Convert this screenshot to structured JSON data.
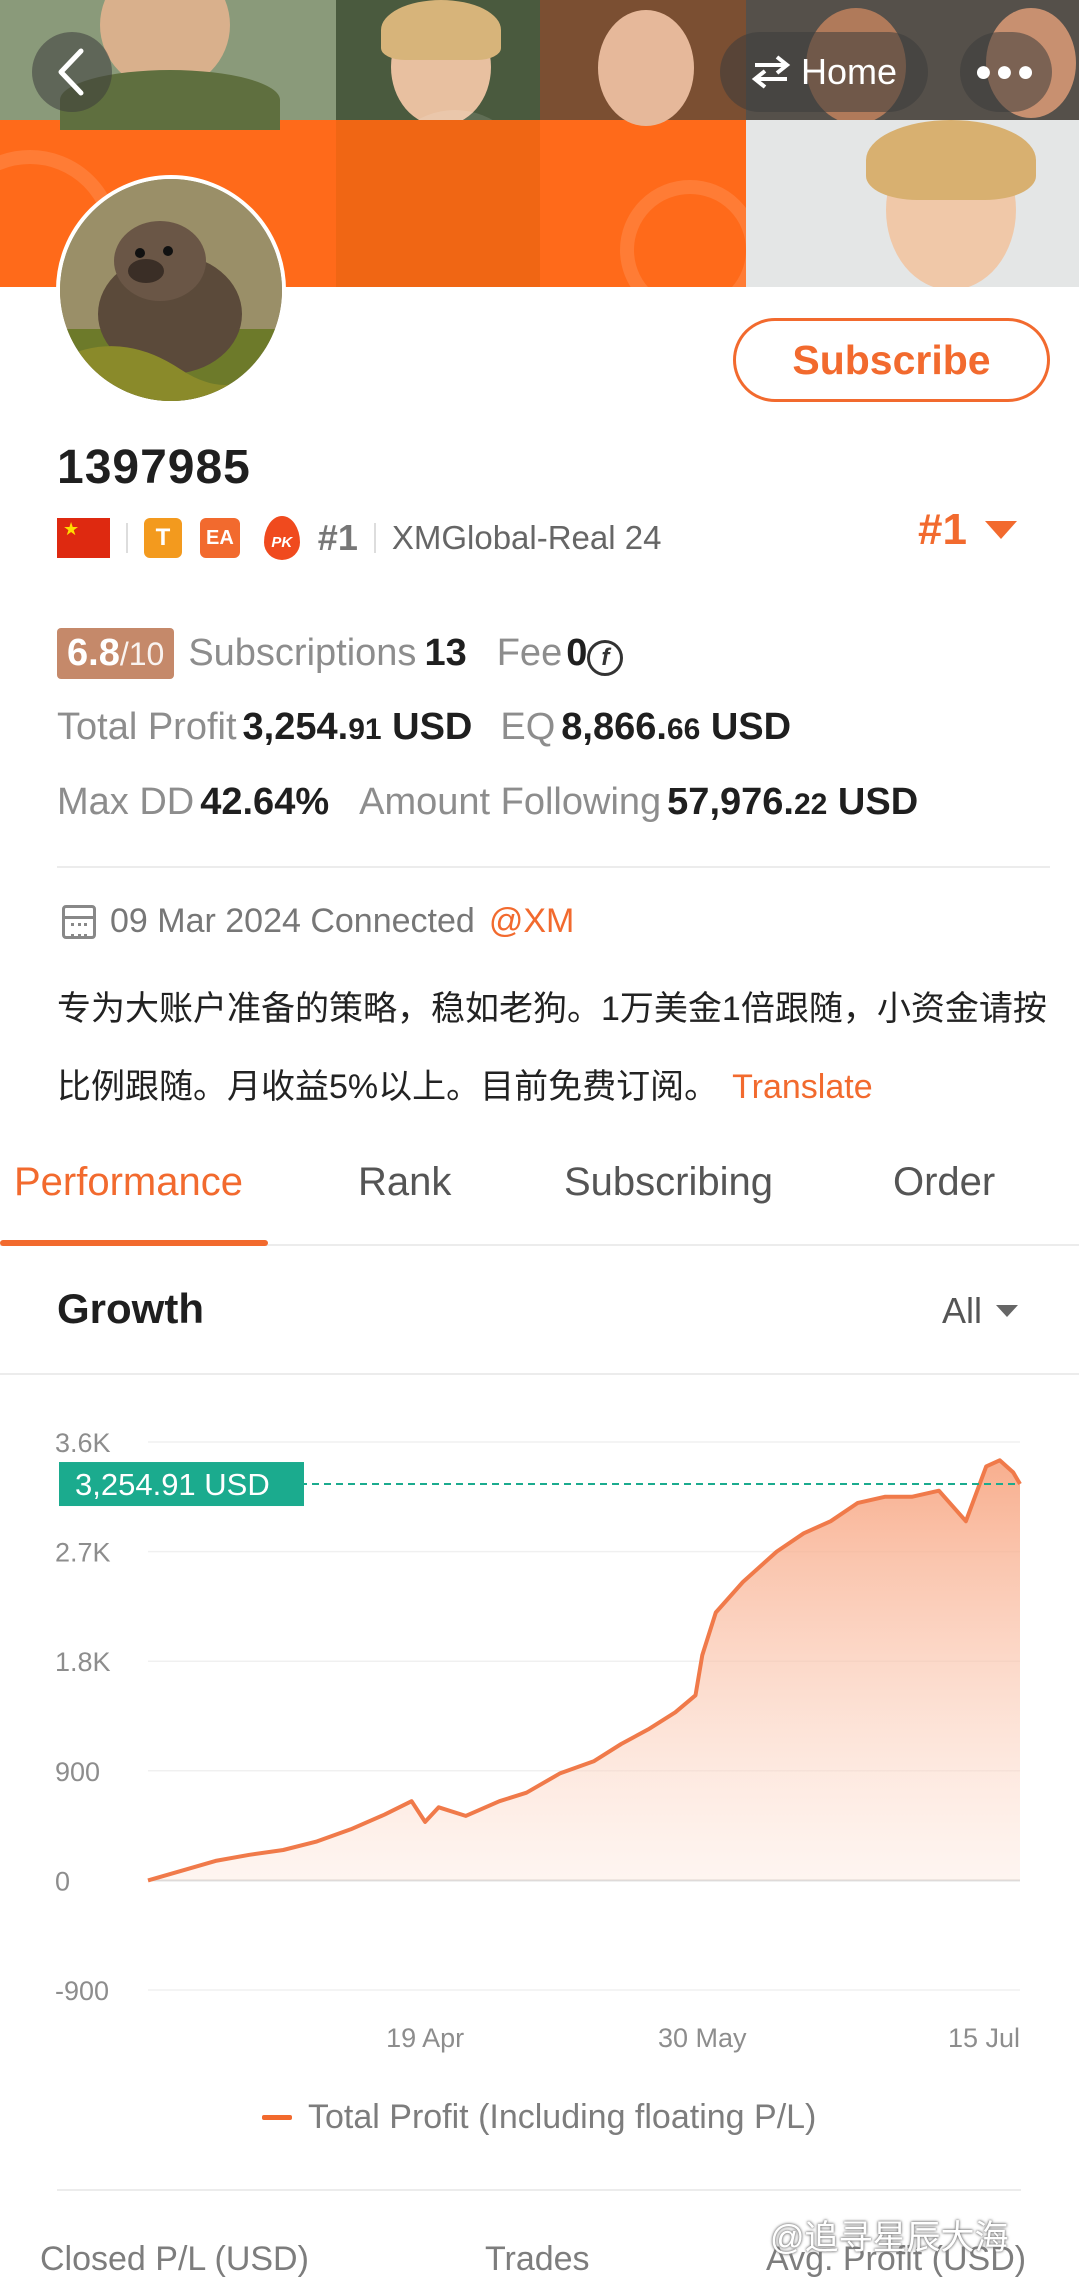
{
  "header": {
    "back_icon": "chevron-left-icon",
    "home_label": "Home",
    "home_icon": "swap-icon",
    "more_icon": "more-dots-icon"
  },
  "profile": {
    "subscribe_label": "Subscribe",
    "account_id": "1397985",
    "badge_t": "T",
    "badge_ea": "EA",
    "badge_pk": "PK",
    "rank": "#1",
    "server": "XMGlobal-Real 24",
    "rank_dropdown": "#1"
  },
  "stats": {
    "score": "6.8",
    "score_max": "/10",
    "subscriptions_label": "Subscriptions",
    "subscriptions_value": "13",
    "fee_label": "Fee",
    "fee_value": "0",
    "fee_icon": "f-coin-icon",
    "total_profit_label": "Total Profit",
    "total_profit_int": "3,254.",
    "total_profit_dec": "91",
    "total_profit_unit": "USD",
    "eq_label": "EQ",
    "eq_int": "8,866.",
    "eq_dec": "66",
    "eq_unit": "USD",
    "max_dd_label": "Max DD",
    "max_dd_value": "42.64%",
    "amount_following_label": "Amount Following",
    "amount_following_int": "57,976.",
    "amount_following_dec": "22",
    "amount_following_unit": "USD"
  },
  "connection": {
    "date_text": "09 Mar 2024 Connected",
    "broker": "@XM"
  },
  "description": {
    "text": "专为大账户准备的策略，稳如老狗。1万美金1倍跟随，小资金请按比例跟随。月收益5%以上。目前免费订阅。",
    "translate_label": "Translate"
  },
  "tabs": [
    "Performance",
    "Rank",
    "Subscribing",
    "Order"
  ],
  "growth": {
    "title": "Growth",
    "range": "All"
  },
  "chart_data": {
    "type": "area",
    "y_ticks": [
      "3.6K",
      "2.7K",
      "1.8K",
      "900",
      "0",
      "-900"
    ],
    "ylim": [
      -900,
      3600
    ],
    "x_ticks": [
      "19 Apr",
      "30 May",
      "15 Jul"
    ],
    "current_value_label": "3,254.91 USD",
    "current_value": 3254.91,
    "series": [
      {
        "name": "Total Profit (Including floating P/L)",
        "x": [
          "2024-03-09",
          "2024-03-14",
          "2024-03-19",
          "2024-03-24",
          "2024-03-29",
          "2024-04-03",
          "2024-04-08",
          "2024-04-13",
          "2024-04-17",
          "2024-04-19",
          "2024-04-21",
          "2024-04-25",
          "2024-04-30",
          "2024-05-04",
          "2024-05-09",
          "2024-05-14",
          "2024-05-18",
          "2024-05-22",
          "2024-05-26",
          "2024-05-29",
          "2024-05-30",
          "2024-06-01",
          "2024-06-05",
          "2024-06-10",
          "2024-06-14",
          "2024-06-18",
          "2024-06-22",
          "2024-06-26",
          "2024-06-30",
          "2024-07-04",
          "2024-07-08",
          "2024-07-11",
          "2024-07-13",
          "2024-07-15",
          "2024-07-16"
        ],
        "y": [
          0,
          80,
          160,
          210,
          250,
          320,
          420,
          540,
          650,
          480,
          600,
          530,
          650,
          720,
          880,
          980,
          1120,
          1240,
          1380,
          1520,
          1850,
          2200,
          2450,
          2700,
          2850,
          2950,
          3100,
          3150,
          3150,
          3200,
          2950,
          3400,
          3450,
          3350,
          3254.91
        ]
      }
    ],
    "legend": "Total Profit (Including floating P/L)",
    "legend_position": "bottom",
    "grid": true
  },
  "bottom_labels": [
    "Closed P/L (USD)",
    "Trades",
    "Avg. Profit (USD)"
  ],
  "watermark": "@追寻星辰大海",
  "colors": {
    "accent": "#f26a2e",
    "chart_fill": "#f9b89a",
    "current_label_bg": "#1bab8e",
    "score_bg": "#c5896a"
  }
}
